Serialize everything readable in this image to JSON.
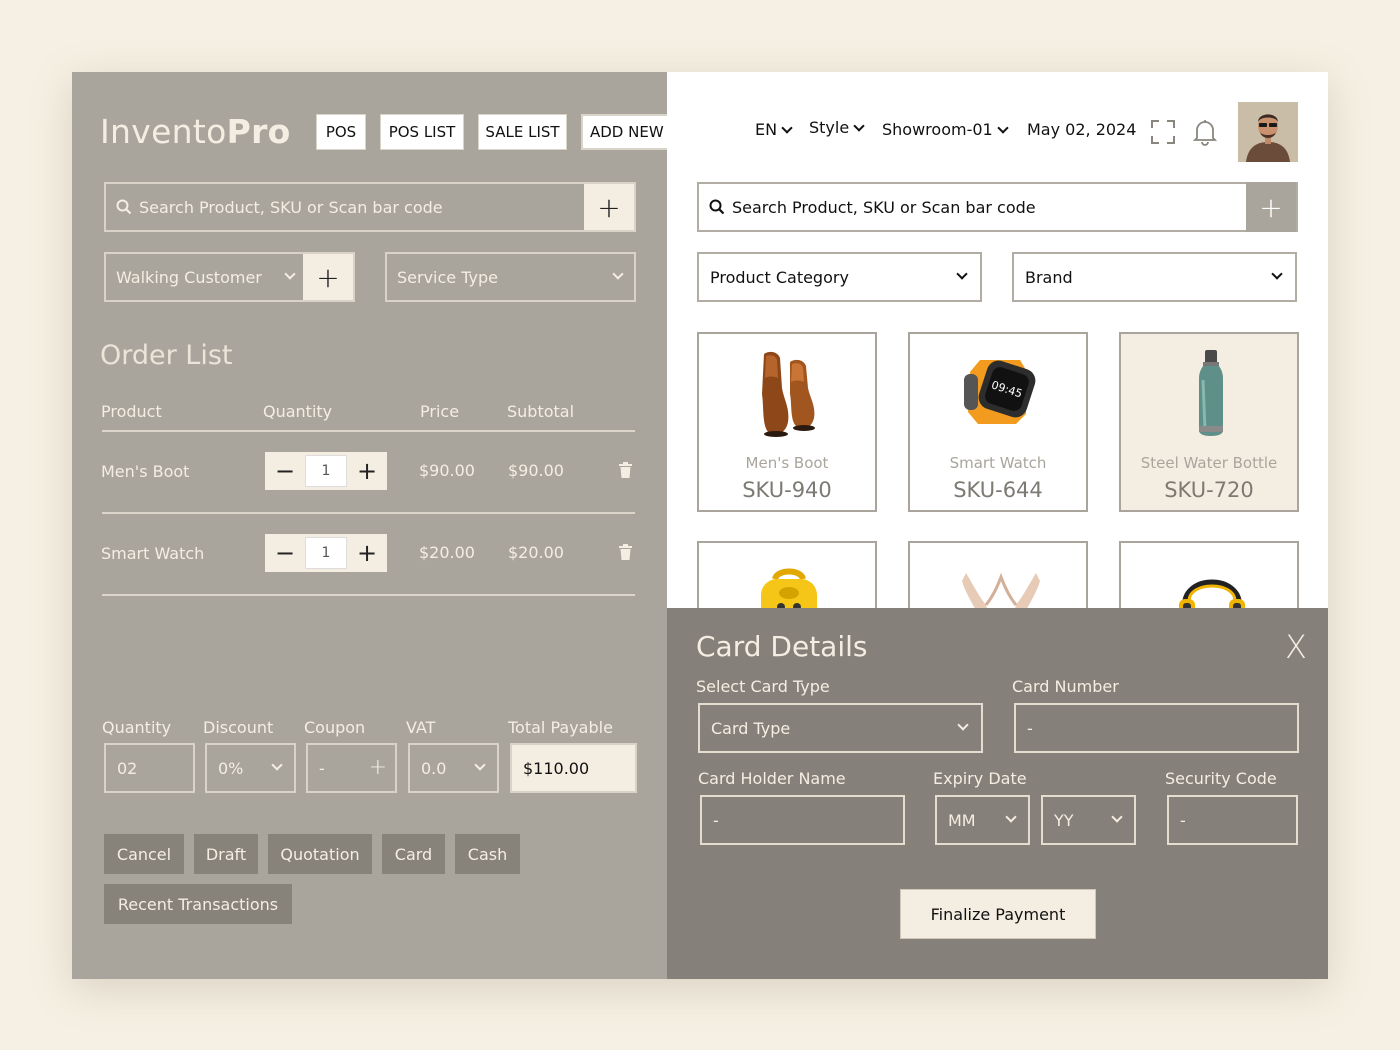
{
  "app": {
    "logo_light": "Invento",
    "logo_bold": "Pro"
  },
  "nav": {
    "pos": "POS",
    "pos_list": "POS LIST",
    "sale_list": "SALE LIST",
    "add_new": "ADD NEW +"
  },
  "left_search": {
    "placeholder": "Search Product, SKU or Scan bar code"
  },
  "customer": {
    "selected": "Walking Customer"
  },
  "service": {
    "selected": "Service Type"
  },
  "order": {
    "title": "Order List",
    "headers": {
      "product": "Product",
      "quantity": "Quantity",
      "price": "Price",
      "subtotal": "Subtotal"
    },
    "rows": [
      {
        "name": "Men's Boot",
        "qty": "1",
        "price": "$90.00",
        "subtotal": "$90.00"
      },
      {
        "name": "Smart Watch",
        "qty": "1",
        "price": "$20.00",
        "subtotal": "$20.00"
      }
    ]
  },
  "summary": {
    "quantity_label": "Quantity",
    "quantity_value": "02",
    "discount_label": "Discount",
    "discount_value": "0%",
    "coupon_label": "Coupon",
    "coupon_value": "-",
    "vat_label": "VAT",
    "vat_value": "0.0",
    "total_label": "Total Payable",
    "total_value": "$110.00"
  },
  "actions": {
    "cancel": "Cancel",
    "draft": "Draft",
    "quotation": "Quotation",
    "card": "Card",
    "cash": "Cash",
    "recent": "Recent Transactions"
  },
  "header": {
    "language": "EN",
    "style": "Style",
    "showroom": "Showroom-01",
    "date": "May 02, 2024"
  },
  "right_search": {
    "placeholder": "Search Product, SKU or Scan bar code"
  },
  "filters": {
    "category": "Product Category",
    "brand": "Brand"
  },
  "products": [
    {
      "name": "Men's Boot",
      "sku": "SKU-940",
      "icon": "boot-icon"
    },
    {
      "name": "Smart Watch",
      "sku": "SKU-644",
      "icon": "smartwatch-icon",
      "watch_time": "09:45"
    },
    {
      "name": "Steel Water Bottle",
      "sku": "SKU-720",
      "icon": "bottle-icon",
      "selected": true
    },
    {
      "name": "",
      "sku": "",
      "icon": "backpack-icon"
    },
    {
      "name": "",
      "sku": "",
      "icon": "heels-icon"
    },
    {
      "name": "",
      "sku": "",
      "icon": "headphones-icon"
    }
  ],
  "card_details": {
    "title": "Card Details",
    "close": "X",
    "card_type_label": "Select Card Type",
    "card_type_value": "Card Type",
    "card_number_label": "Card Number",
    "card_number_value": "-",
    "holder_label": "Card Holder Name",
    "holder_value": "-",
    "expiry_label": "Expiry Date",
    "expiry_month": "MM",
    "expiry_year": "YY",
    "security_label": "Security Code",
    "security_value": "-",
    "finalize": "Finalize Payment"
  },
  "colors": {
    "left_bg": "#a9a59d",
    "panel_bg": "#85817a",
    "cream": "#f4eee2",
    "page_bg": "#f6f0e4"
  }
}
